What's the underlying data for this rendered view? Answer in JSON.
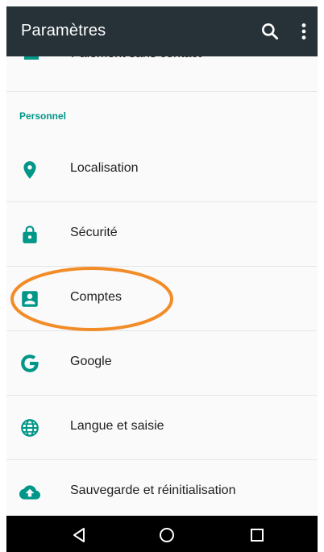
{
  "toolbar": {
    "title": "Paramètres",
    "search_icon": "search-icon",
    "more_icon": "more-vert-icon",
    "background": "#263238"
  },
  "cutoff_item": {
    "label": "Paiement sans contact"
  },
  "section": {
    "label": "Personnel"
  },
  "items": [
    {
      "label": "Localisation",
      "icon": "location-icon"
    },
    {
      "label": "Sécurité",
      "icon": "lock-icon"
    },
    {
      "label": "Comptes",
      "icon": "account-box-icon"
    },
    {
      "label": "Google",
      "icon": "google-icon"
    },
    {
      "label": "Langue et saisie",
      "icon": "language-icon"
    },
    {
      "label": "Sauvegarde et réinitialisation",
      "icon": "cloud-upload-icon"
    }
  ],
  "colors": {
    "accent": "#009688",
    "highlight": "#f28c28",
    "text": "#212121"
  },
  "navbar": {
    "back_icon": "back-icon",
    "home_icon": "home-icon",
    "recents_icon": "recents-icon"
  }
}
